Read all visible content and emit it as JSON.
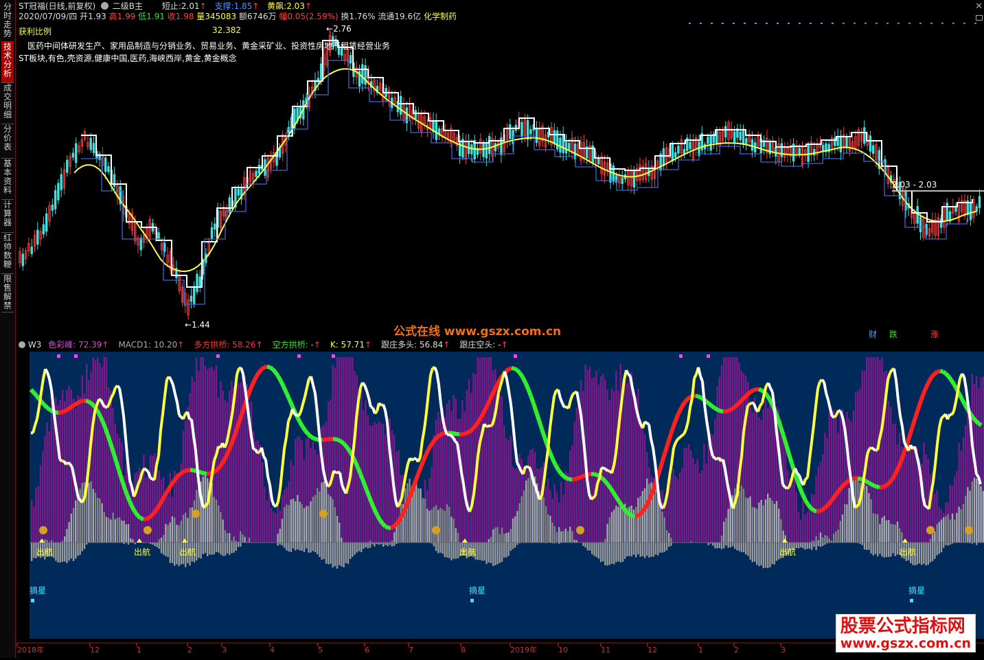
{
  "sidebar": {
    "tabs": [
      {
        "label": "分时走势",
        "active": false
      },
      {
        "label": "技术分析",
        "active": true
      },
      {
        "label": "成交明细",
        "active": false
      },
      {
        "label": "分价表",
        "active": false
      },
      {
        "label": "基本资料",
        "active": false
      },
      {
        "label": "计算器",
        "active": false
      },
      {
        "label": "红帅数鞭",
        "active": false
      },
      {
        "label": "限售解禁",
        "active": false
      }
    ]
  },
  "header": {
    "stock_name": "ST冠福(日线,前复权)",
    "indicator": "二级B主",
    "short_stop_label": "短止:",
    "short_stop_value": "2.01",
    "support_label": "支撑:",
    "support_value": "1.85",
    "yellow_label": "黄飙:",
    "yellow_value": "2.03",
    "date_line": {
      "date": "2020/07/09/四",
      "open_label": "开",
      "open": "1.93",
      "high_label": "高",
      "high": "1.99",
      "low_label": "低",
      "low": "1.91",
      "close_label": "收",
      "close": "1.98",
      "vol_label": "量",
      "vol": "345083",
      "amount_label": "额",
      "amount": "6746万",
      "change_label": "幅",
      "change": "0.05(2.59%)",
      "turnover_label": "换",
      "turnover": "1.76%",
      "float_label": "流通",
      "float": "19.6亿",
      "sector": "化学制药"
    },
    "profit_ratio_label": "获利比例",
    "profit_ratio_value": "32.382",
    "business": "医药中间体研发生产、家用品制造与分销业务、贸易业务、黄金采矿业、投资性房地产租赁经营业务",
    "concepts": "ST板块,有色,壳资源,健康中国,医药,海峡西岸,黄金,黄金概念"
  },
  "price_annotations": {
    "high_mark": "2.76",
    "low_mark": "1.44",
    "range_label": "2.03 - 2.03"
  },
  "watermark_center": "公式在线  www.gszx.com.cn",
  "flags": {
    "cai": "财",
    "die": "跌",
    "zhang": "涨"
  },
  "subpanel": {
    "name": "W3",
    "items": [
      {
        "label": "色彩峰: 72.39",
        "color": "#d050d0"
      },
      {
        "label": "MACD1: 10.20",
        "color": "#aaaaaa"
      },
      {
        "label": "多方拱桥: 58.26",
        "color": "#ff3030"
      },
      {
        "label": "空方拱桥: -",
        "color": "#30e030"
      },
      {
        "label": "K: 57.71",
        "color": "#ffff40"
      },
      {
        "label": "跟庄多头: 56.84",
        "color": "#dddddd"
      },
      {
        "label": "跟庄空头: -",
        "color": "#dddddd"
      }
    ],
    "signal_chuhang": "出航",
    "signal_zhaixing": "摘星"
  },
  "time_axis": [
    "2018年",
    "12",
    "1",
    "2",
    "3",
    "4",
    "5",
    "6",
    "7",
    "8",
    "2019年",
    "10",
    "11",
    "12",
    "1",
    "2",
    "3"
  ],
  "watermark_corner": {
    "line1": "股票公式指标网",
    "line2": "www.gszx.com.cn"
  },
  "colors": {
    "up": "#ff4040",
    "down": "#40e0e0",
    "yellow": "#ffff40",
    "white": "#ffffff",
    "blue": "#3a6ad8",
    "panel_bg": "#002a5a",
    "purple": "#7a1a8a"
  }
}
